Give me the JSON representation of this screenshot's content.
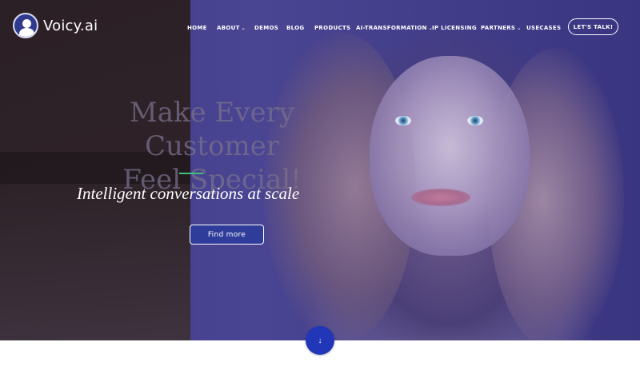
{
  "brand": {
    "name": "Voicy.ai"
  },
  "nav": {
    "items": [
      {
        "label": "HOME",
        "has_dropdown": false
      },
      {
        "label": "ABOUT",
        "has_dropdown": true
      },
      {
        "label": "DEMOS",
        "has_dropdown": false
      },
      {
        "label": "BLOG",
        "has_dropdown": false
      },
      {
        "label": "PRODUCTS",
        "has_dropdown": false
      },
      {
        "label": "AI-TRANSFORMATION",
        "has_dropdown": true
      },
      {
        "label": "IP LICENSING",
        "has_dropdown": false
      },
      {
        "label": "PARTNERS",
        "has_dropdown": true
      },
      {
        "label": "USECASES",
        "has_dropdown": false
      }
    ],
    "cta_label": "LET'S TALK!",
    "dropdown_glyph": "⌄"
  },
  "hero": {
    "headline_line1": "Make Every Customer",
    "headline_line2": "Feel Special!",
    "tagline": "Intelligent conversations at scale",
    "button_label": "Find more",
    "scroll_icon": "arrow-down-icon",
    "scroll_glyph": "↓"
  },
  "colors": {
    "hero_tint": "#3f3a86",
    "accent_divider": "#3ec07a",
    "button_bg": "#2f3c9a",
    "scroll_button_bg": "#2236b8",
    "text": "#ffffff"
  }
}
